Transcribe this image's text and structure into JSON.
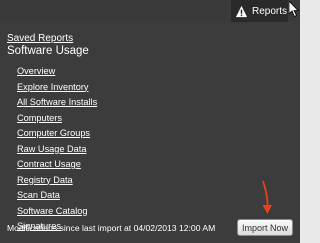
{
  "topbar": {
    "reports_tab": {
      "label": "Reports",
      "icon": "warning-icon"
    }
  },
  "panel": {
    "saved_reports": "Saved Reports",
    "section_title": "Software Usage",
    "menu_items": [
      "Overview",
      "Explore Inventory",
      "All Software Installs",
      "Computers",
      "Computer Groups",
      "Raw Usage Data",
      "Contract Usage",
      "Registry Data",
      "Scan Data",
      "Software Catalog",
      "Signatures"
    ],
    "status_text": "Modifications since last import at 04/02/2013 12:00 AM",
    "import_button": "Import Now"
  },
  "colors": {
    "topbar_bg": "#3a3a3a",
    "tab_bg": "#2a2a2a",
    "panel_bg": "#3c3c3c",
    "link_text": "#ffffff",
    "annotation_arrow": "#e8401a"
  }
}
